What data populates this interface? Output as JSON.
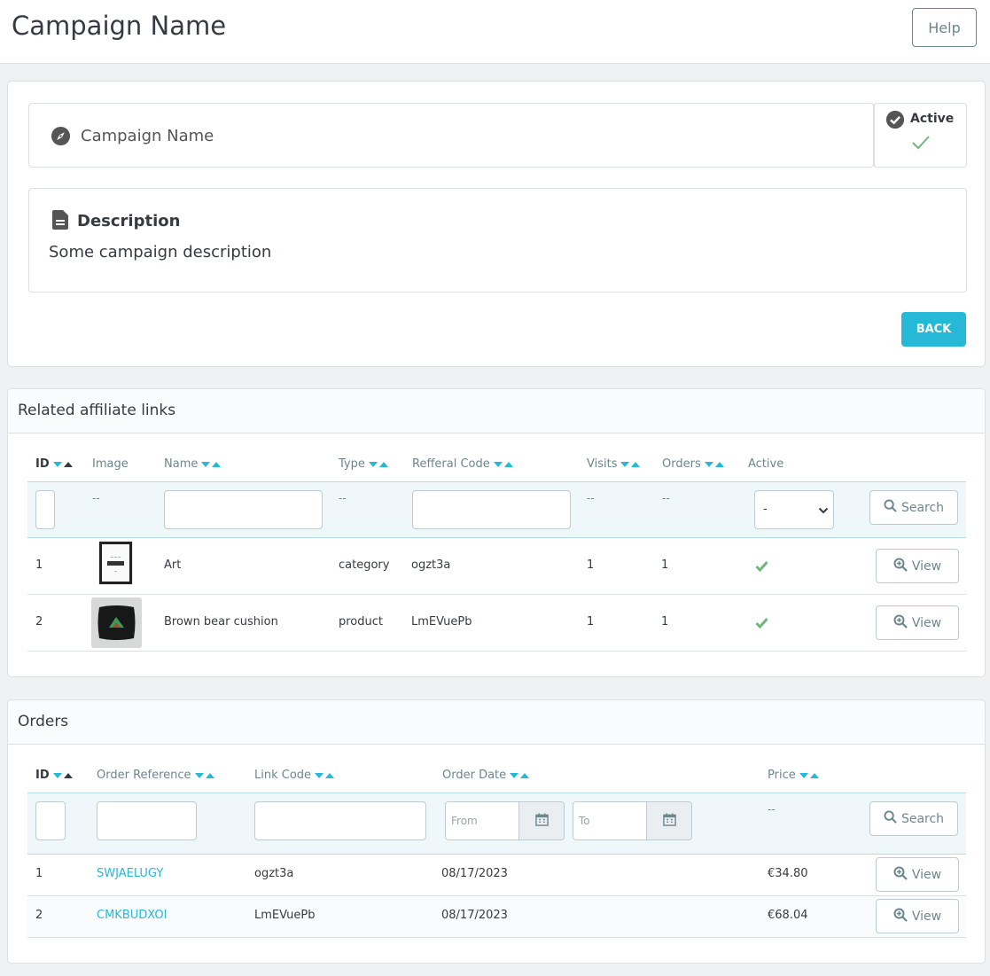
{
  "header": {
    "title": "Campaign Name",
    "help_label": "Help"
  },
  "campaign": {
    "name": "Campaign Name",
    "status_label": "Active",
    "description_title": "Description",
    "description_text": "Some campaign description",
    "back_label": "BACK"
  },
  "affiliate_links": {
    "title": "Related affiliate links",
    "columns": [
      "ID",
      "Image",
      "Name",
      "Type",
      "Refferal Code",
      "Visits",
      "Orders",
      "Active"
    ],
    "filter_placeholder_dash": "--",
    "active_select_value": "-",
    "search_label": "Search",
    "view_label": "View",
    "rows": [
      {
        "id": "1",
        "name": "Art",
        "type": "category",
        "code": "ogzt3a",
        "visits": "1",
        "orders": "1",
        "active": true
      },
      {
        "id": "2",
        "name": "Brown bear cushion",
        "type": "product",
        "code": "LmEVuePb",
        "visits": "1",
        "orders": "1",
        "active": true
      }
    ]
  },
  "orders": {
    "title": "Orders",
    "columns": [
      "ID",
      "Order Reference",
      "Link Code",
      "Order Date",
      "Price"
    ],
    "from_placeholder": "From",
    "to_placeholder": "To",
    "filter_placeholder_dash": "--",
    "search_label": "Search",
    "view_label": "View",
    "rows": [
      {
        "id": "1",
        "reference": "SWJAELUGY",
        "link_code": "ogzt3a",
        "date": "08/17/2023",
        "price": "€34.80"
      },
      {
        "id": "2",
        "reference": "CMKBUDXOI",
        "link_code": "LmEVuePb",
        "date": "08/17/2023",
        "price": "€68.04"
      }
    ]
  },
  "colors": {
    "accent": "#25b9d7",
    "success": "#70b580",
    "text": "#363a41",
    "muted": "#6c868e"
  }
}
